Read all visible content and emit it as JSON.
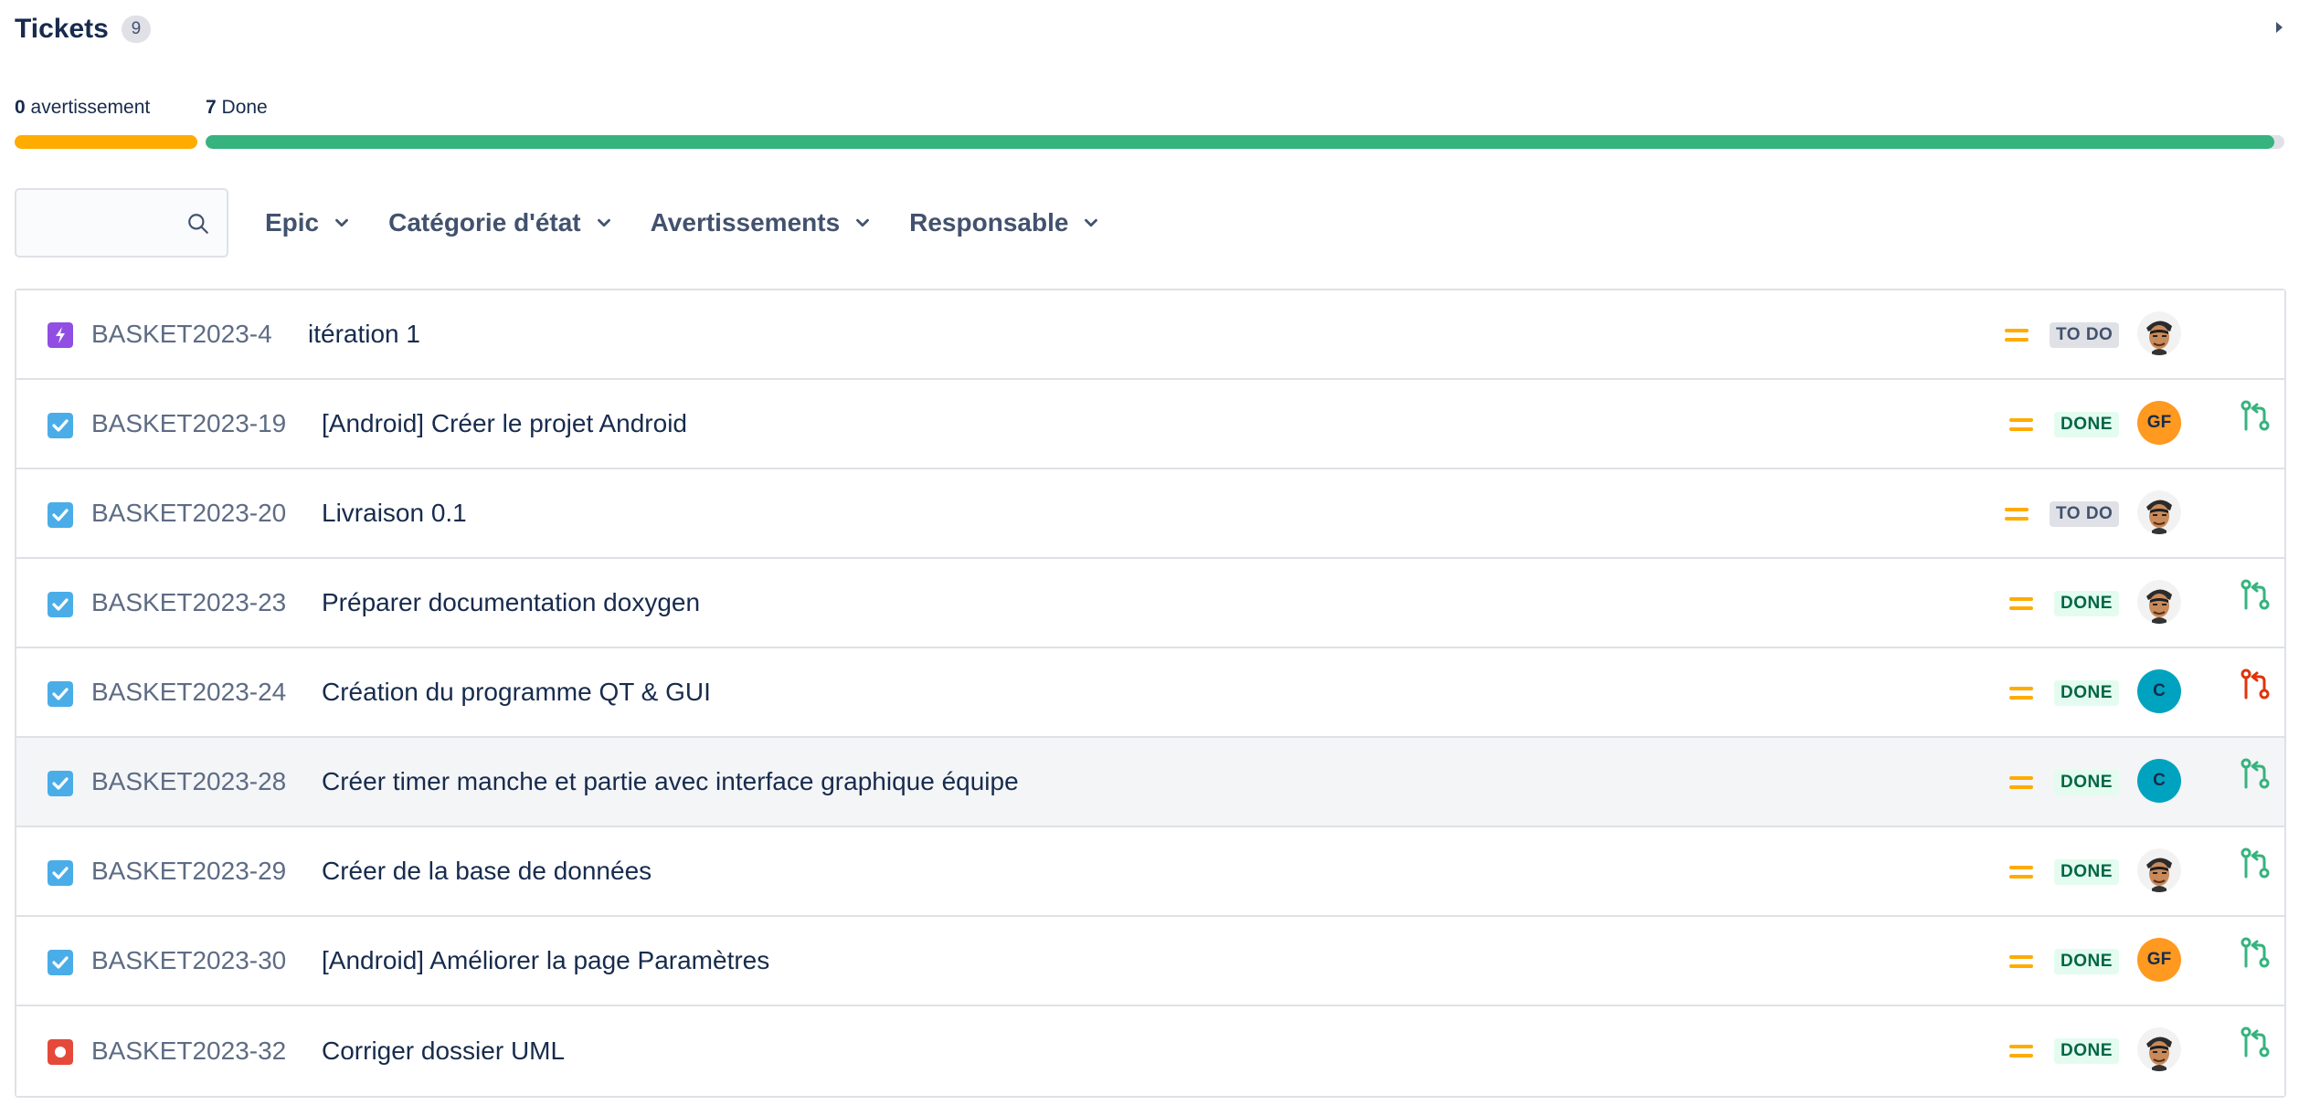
{
  "header": {
    "title": "Tickets",
    "count": "9"
  },
  "progress": {
    "warnings": {
      "count": "0",
      "label": "avertissement",
      "color": "#FFAB00"
    },
    "done": {
      "count": "7",
      "label": "Done",
      "color": "#36B37E",
      "fraction": 0.995
    }
  },
  "filters": {
    "search": {
      "placeholder": "",
      "value": ""
    },
    "items": [
      {
        "label": "Epic"
      },
      {
        "label": "Catégorie d'état"
      },
      {
        "label": "Avertissements"
      },
      {
        "label": "Responsable"
      }
    ]
  },
  "tickets": [
    {
      "key": "BASKET2023-4",
      "summary": "itération 1",
      "type": "epic-icon",
      "priority": "medium-priority-icon",
      "status": "TO DO",
      "assignee": "photo",
      "dev": ""
    },
    {
      "key": "BASKET2023-19",
      "summary": "[Android] Créer le projet Android",
      "type": "task-icon",
      "priority": "medium-priority-icon",
      "status": "DONE",
      "assignee": "GF",
      "dev": "merged"
    },
    {
      "key": "BASKET2023-20",
      "summary": "Livraison 0.1",
      "type": "task-icon",
      "priority": "medium-priority-icon",
      "status": "TO DO",
      "assignee": "photo",
      "dev": ""
    },
    {
      "key": "BASKET2023-23",
      "summary": "Préparer documentation doxygen",
      "type": "task-icon",
      "priority": "medium-priority-icon",
      "status": "DONE",
      "assignee": "photo",
      "dev": "merged"
    },
    {
      "key": "BASKET2023-24",
      "summary": "Création du programme QT & GUI",
      "type": "task-icon",
      "priority": "medium-priority-icon",
      "status": "DONE",
      "assignee": "C",
      "dev": "declined"
    },
    {
      "key": "BASKET2023-28",
      "summary": "Créer timer manche et partie avec interface graphique équipe",
      "type": "task-icon",
      "priority": "medium-priority-icon",
      "status": "DONE",
      "assignee": "C",
      "dev": "merged"
    },
    {
      "key": "BASKET2023-29",
      "summary": "Créer de la base de données",
      "type": "task-icon",
      "priority": "medium-priority-icon",
      "status": "DONE",
      "assignee": "photo",
      "dev": "merged"
    },
    {
      "key": "BASKET2023-30",
      "summary": "[Android] Améliorer la page Paramètres",
      "type": "task-icon",
      "priority": "medium-priority-icon",
      "status": "DONE",
      "assignee": "GF",
      "dev": "merged"
    },
    {
      "key": "BASKET2023-32",
      "summary": "Corriger dossier UML",
      "type": "bug-icon",
      "priority": "medium-priority-icon",
      "status": "DONE",
      "assignee": "photo",
      "dev": "merged"
    }
  ],
  "colors": {
    "epic": "#904EE2",
    "task": "#4BADE8",
    "bug": "#E5493A",
    "priority_medium": "#FFAB00",
    "pr_merged": "#36B37E",
    "pr_declined": "#DE350B"
  }
}
